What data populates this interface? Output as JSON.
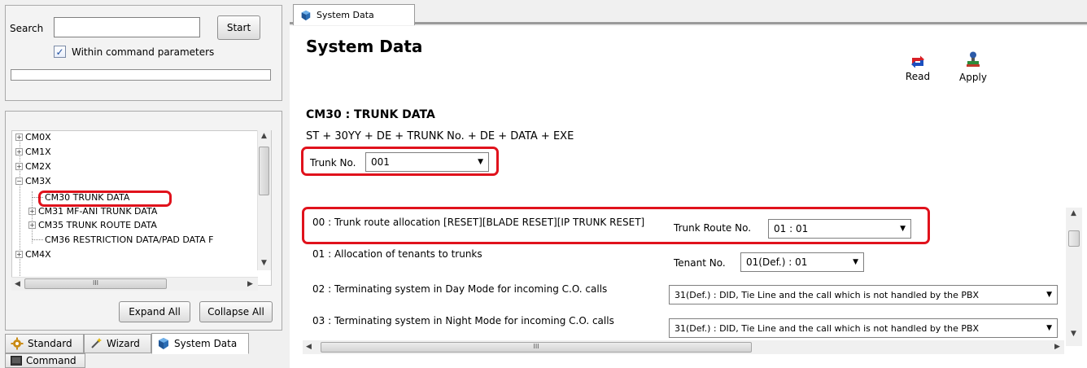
{
  "search": {
    "label": "Search",
    "value": "",
    "start_label": "Start",
    "within_label": "Within command parameters",
    "within_checked": true,
    "check_glyph": "✓"
  },
  "tree": {
    "items": [
      {
        "label": "CM0X",
        "expander": "+"
      },
      {
        "label": "CM1X",
        "expander": "+"
      },
      {
        "label": "CM2X",
        "expander": "+"
      },
      {
        "label": "CM3X",
        "expander": "−"
      },
      {
        "label": "CM30 TRUNK DATA",
        "expander": ""
      },
      {
        "label": "CM31 MF-ANI TRUNK DATA",
        "expander": "+"
      },
      {
        "label": "CM35 TRUNK ROUTE DATA",
        "expander": "+"
      },
      {
        "label": "CM36 RESTRICTION DATA/PAD DATA F",
        "expander": ""
      },
      {
        "label": "CM4X",
        "expander": "+"
      }
    ],
    "hscroll_glyph": "III",
    "expand_all": "Expand All",
    "collapse_all": "Collapse All"
  },
  "bottom_tabs": {
    "standard": "Standard",
    "wizard": "Wizard",
    "system_data": "System Data",
    "command": "Command"
  },
  "doc_tab": {
    "label": "System Data"
  },
  "main": {
    "title": "System Data",
    "read_label": "Read",
    "apply_label": "Apply",
    "cm_title": "CM30 : TRUNK DATA",
    "formula": "ST + 30YY + DE + TRUNK No. + DE + DATA + EXE",
    "trunk_no_label": "Trunk No.",
    "trunk_no_value": "001"
  },
  "rows": [
    {
      "text": "00 : Trunk route allocation [RESET][BLADE RESET][IP TRUNK RESET]",
      "field_label": "Trunk Route No.",
      "value": "01 : 01"
    },
    {
      "text": "01 : Allocation of tenants to trunks",
      "field_label": "Tenant No.",
      "value": "01(Def.) : 01"
    },
    {
      "text": "02 : Terminating system in Day Mode for incoming C.O. calls",
      "field_label": "",
      "value": "31(Def.) : DID, Tie Line and the call which is not handled by the PBX"
    },
    {
      "text": "03 : Terminating system in Night Mode for incoming C.O. calls",
      "field_label": "",
      "value": "31(Def.) : DID, Tie Line and the call which is not handled by the PBX"
    }
  ],
  "colors": {
    "highlight": "#e0121c",
    "read_icon": "#d81f26",
    "read_icon_secondary": "#1b4fbf"
  }
}
